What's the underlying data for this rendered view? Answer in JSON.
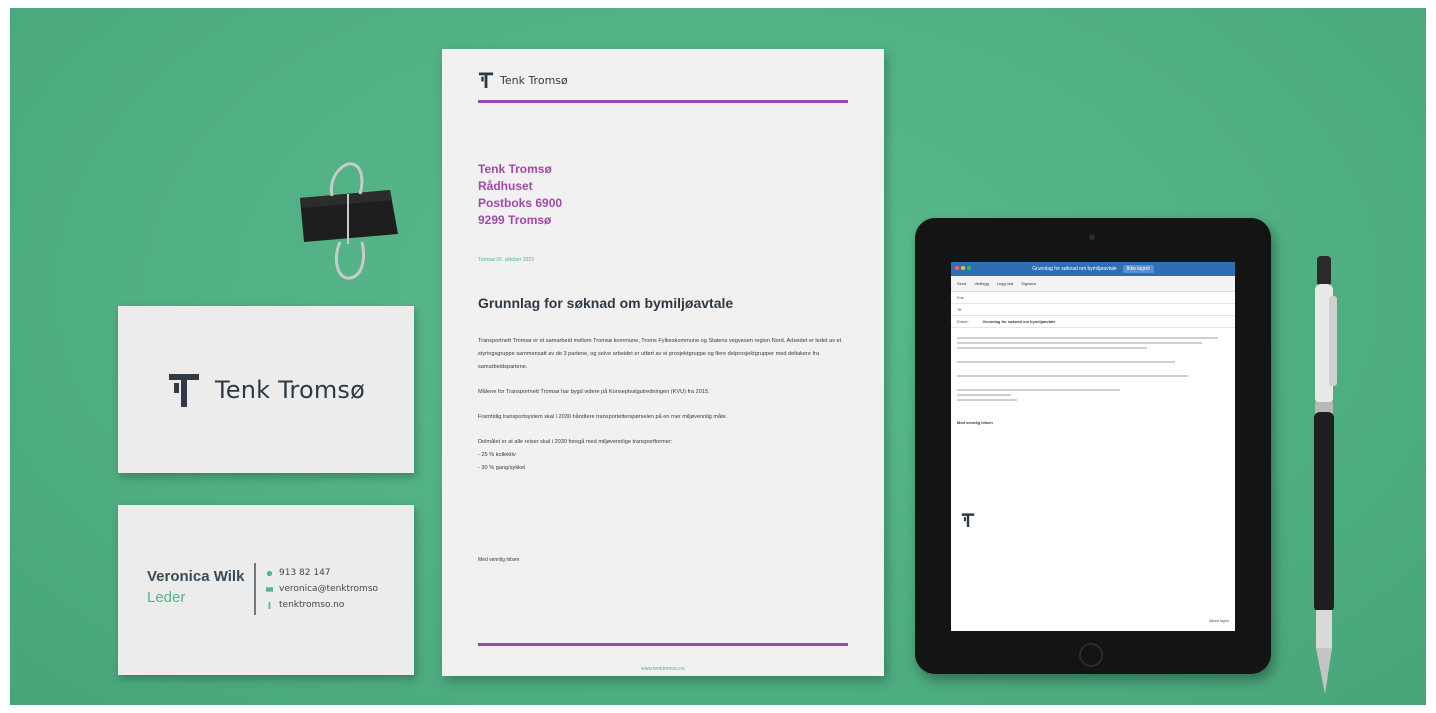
{
  "colors": {
    "background": "#4fae82",
    "accent_purple": "#a04aa8",
    "accent_green": "#55b489",
    "text_dark": "#2f3a45"
  },
  "brand": {
    "name": "Tenk Tromsø"
  },
  "business_card_back": {
    "name": "Veronica Wilk",
    "role": "Leder",
    "phone": "913 82 147",
    "email": "veronica@tenktromso",
    "web": "tenktromso.no"
  },
  "letter": {
    "header_brand": "Tenk Tromsø",
    "address_lines": [
      "Tenk Tromsø",
      "Rådhuset",
      "Postboks 6900",
      "9299 Tromsø"
    ],
    "date": "Tromsø 05. oktober 2023",
    "subject": "Grunnlag for søknad om bymiljøavtale",
    "paragraphs": [
      "Transportnett Tromsø er et samarbeid mellom Tromsø kommune, Troms Fylkeskommune og Statens vegvesen region Nord. Arbeidet er ledet av et styringsgruppe sammensatt av de 3 partene, og selve arbeidet er utført av ei prosjektgruppe og flere delprosjektgrupper med deltakere fra samarbeidspartene.",
      "Målene for Transportnett Tromsø har bygd videre på Konseptvalgutredningen (KVU) fra 2015.",
      "Framtidig transportsystem skal i 2030 håndtere transportetterspørselen på en mer miljøvennlig måte.",
      "Delmålet er at alle reiser skal i 2030 foregå med miljøvennlige transportformer:",
      "- 25 % kollektiv",
      "- 30 % gang/sykkel"
    ],
    "signoff": "Med vennlig hilsen",
    "footer": "www.tenktromso.no"
  },
  "tablet_email": {
    "window_title": "Grunnlag for søknad om bymiljøavtale",
    "window_tag": "Ikke lagret",
    "toolbar": [
      "Send",
      "Vedlegg",
      "Legg ved",
      "Signatur"
    ],
    "from_label": "Fra:",
    "to_label": "Til:",
    "subject_label": "Emne:",
    "subject": "Grunnlag for søknad om bymiljøavtale",
    "signoff": "Med vennlig hilsen",
    "status": "Utkast lagret"
  }
}
